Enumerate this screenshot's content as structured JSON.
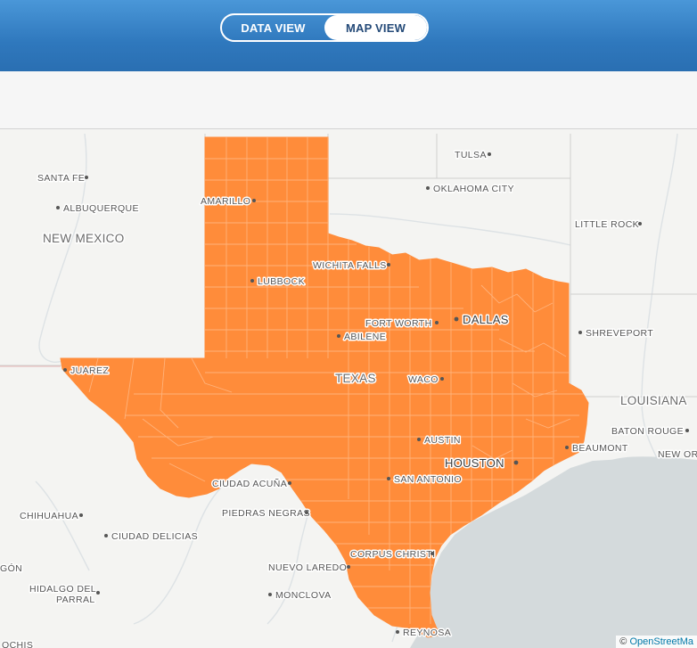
{
  "header": {
    "tabs": [
      {
        "label": "DATA VIEW",
        "active": false
      },
      {
        "label": "MAP VIEW",
        "active": true
      }
    ]
  },
  "map": {
    "fill_color": "#ff8c3a",
    "county_line_color": "#ffb27a",
    "water_color": "#d4dadc",
    "land_color": "#f4f4f2",
    "state_label": "TEXAS",
    "region_labels": {
      "new_mexico": "NEW MEXICO",
      "louisiana": "LOUISIANA"
    },
    "cities": {
      "santa_fe": "SANTA FE",
      "albuquerque": "ALBUQUERQUE",
      "amarillo": "AMARILLO",
      "tulsa": "TULSA",
      "oklahoma_city": "OKLAHOMA CITY",
      "little_rock": "LITTLE ROCK",
      "wichita_falls": "WICHITA FALLS",
      "lubbock": "LUBBOCK",
      "fort_worth": "FORT WORTH",
      "dallas": "DALLAS",
      "abilene": "ABILENE",
      "shreveport": "SHREVEPORT",
      "juarez": "JUAREZ",
      "waco": "WACO",
      "baton_rouge": "BATON ROUGE",
      "austin": "AUSTIN",
      "beaumont": "BEAUMONT",
      "houston": "HOUSTON",
      "new_orleans": "NEW OR",
      "ciudad_acuna": "CIUDAD ACUÑA",
      "san_antonio": "SAN ANTONIO",
      "chihuahua": "CHIHUAHUA",
      "piedras_negras": "PIEDRAS NEGRAS",
      "ciudad_delicias": "CIUDAD DELICIAS",
      "corpus_christi": "CORPUS CHRISTI",
      "gon": "GÓN",
      "nuevo_laredo": "NUEVO LAREDO",
      "hidalgo_line1": "HIDALGO DEL",
      "hidalgo_line2": "PARRAL",
      "monclova": "MONCLOVA",
      "reynosa": "REYNOSA",
      "ochis": "OCHIS"
    }
  },
  "attribution": {
    "prefix": "© ",
    "link": "OpenStreetMa"
  }
}
